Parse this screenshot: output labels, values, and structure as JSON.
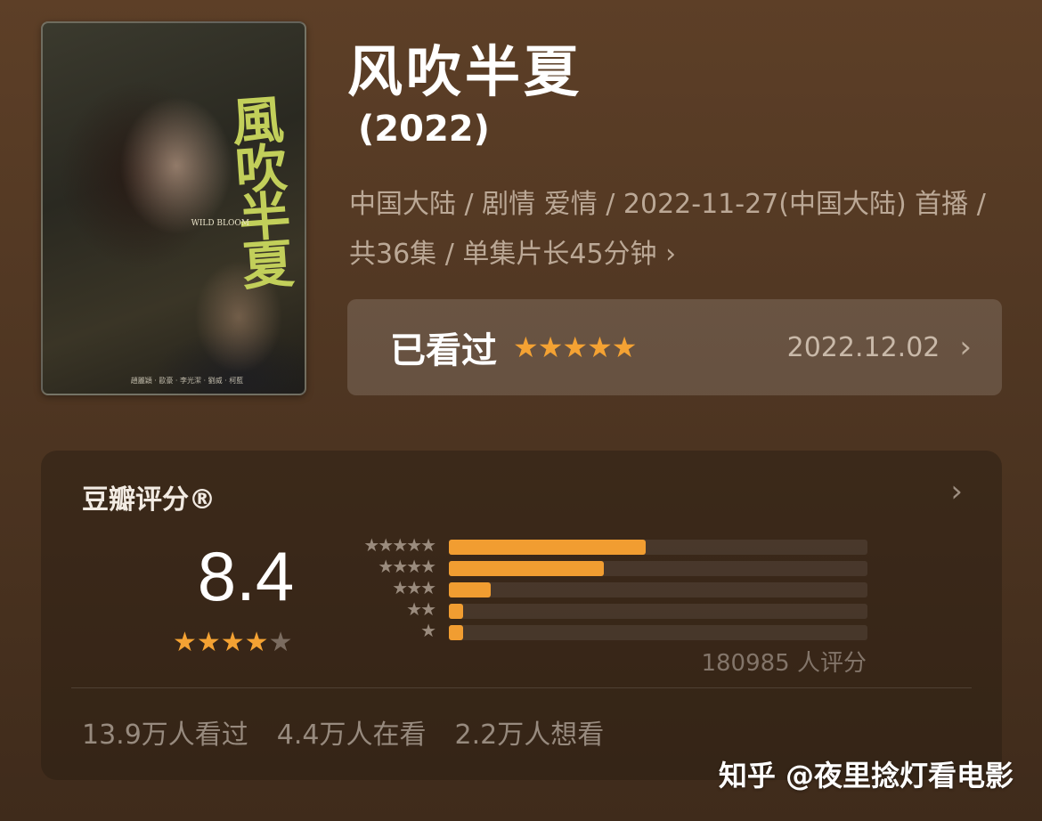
{
  "poster": {
    "calligraphy": "風吹半夏",
    "english": "WILD BLOOM",
    "credits": "趙麗穎 · 歐豪 · 李光潔 · 劉威 · 柯藍"
  },
  "title": "风吹半夏",
  "year": "(2022)",
  "meta": {
    "line": "中国大陆 / 剧情 爱情 / 2022-11-27(中国大陆) 首播 / 共36集 / 单集片长45分钟",
    "chevron": "›"
  },
  "watched": {
    "label": "已看过",
    "stars": "★★★★★",
    "rating": 5,
    "date": "2022.12.02",
    "chevron": "›"
  },
  "rating_card": {
    "title": "豆瓣评分®",
    "chevron": "›",
    "score": "8.4",
    "stars_on": "★★★★",
    "stars_off": "★",
    "distribution": [
      {
        "stars": "★★★★★",
        "fraction": 0.47
      },
      {
        "stars": "★★★★",
        "fraction": 0.37
      },
      {
        "stars": "★★★",
        "fraction": 0.1
      },
      {
        "stars": "★★",
        "fraction": 0.035
      },
      {
        "stars": "★",
        "fraction": 0.035
      }
    ],
    "rater_count": "180985 人评分",
    "stats": [
      "13.9万人看过",
      "4.4万人在看",
      "2.2万人想看"
    ]
  },
  "watermark": "知乎 @夜里捻灯看电影",
  "colors": {
    "accent": "#f4a233",
    "background": "#4f3622"
  }
}
